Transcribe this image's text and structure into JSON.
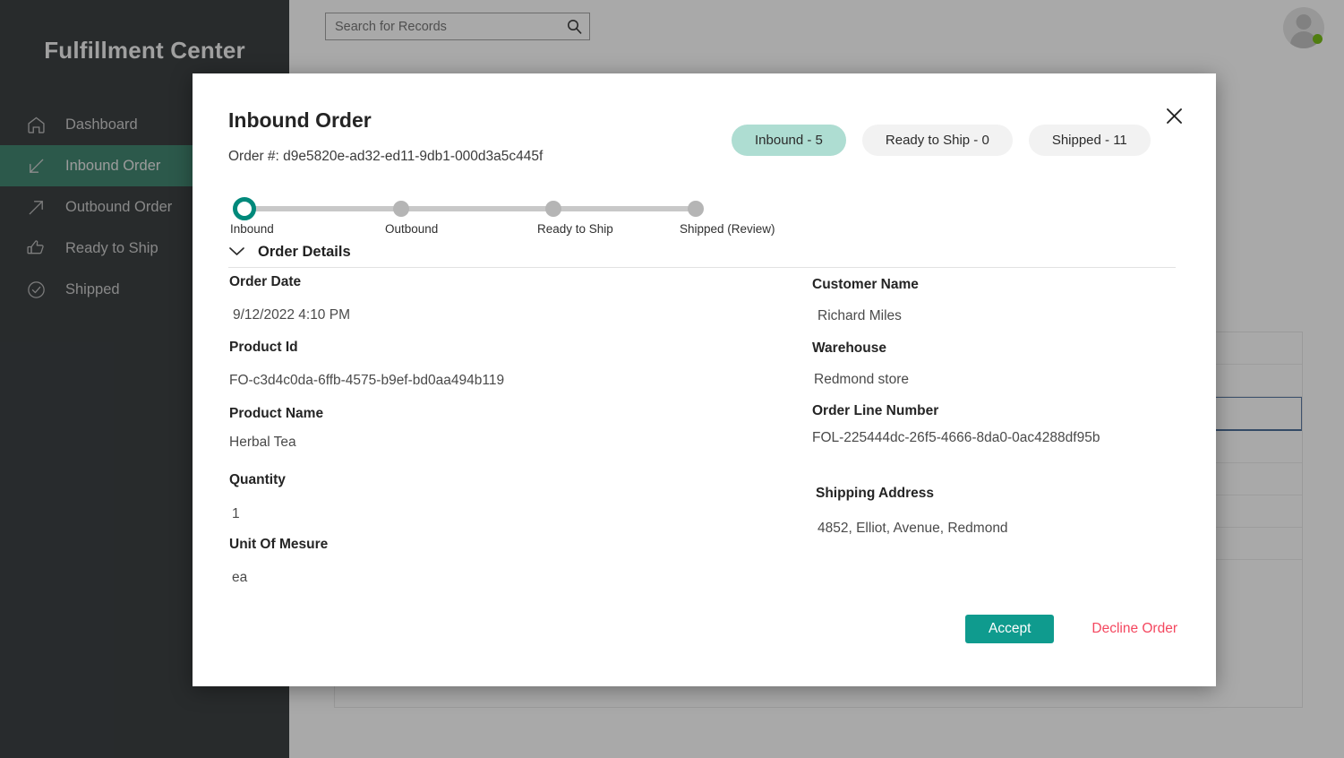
{
  "app": {
    "brand": "Fulfillment Center"
  },
  "search": {
    "placeholder": "Search for Records",
    "value": "",
    "icon": "search-icon"
  },
  "account": {
    "avatar_icon": "user-avatar-icon",
    "presence": "online",
    "presence_color": "#6bb700"
  },
  "sidebar": {
    "items": [
      {
        "label": "Dashboard",
        "icon": "home-icon",
        "active": false
      },
      {
        "label": "Inbound Order",
        "icon": "arrow-down-left-icon",
        "active": true
      },
      {
        "label": "Outbound Order",
        "icon": "arrow-up-right-icon",
        "active": false
      },
      {
        "label": "Ready to Ship",
        "icon": "thumbs-up-icon",
        "active": false
      },
      {
        "label": "Shipped",
        "icon": "check-circle-icon",
        "active": false
      }
    ],
    "active_bg": "#2f7a63",
    "bg": "#282d30"
  },
  "modal": {
    "title": "Inbound Order",
    "order_number_label": "Order #: d9e5820e-ad32-ed11-9db1-000d3a5c445f",
    "close_icon": "close-icon",
    "pills": [
      {
        "label": "Inbound - 5",
        "active": true
      },
      {
        "label": "Ready to Ship - 0",
        "active": false
      },
      {
        "label": "Shipped - 11",
        "active": false
      }
    ],
    "pill_active_color": "#aeddd2",
    "stepper": {
      "steps": [
        {
          "label": "Inbound",
          "state": "current"
        },
        {
          "label": "Outbound",
          "state": "upcoming"
        },
        {
          "label": "Ready to Ship",
          "state": "upcoming"
        },
        {
          "label": "Shipped (Review)",
          "state": "upcoming"
        }
      ],
      "active_color": "#00897b",
      "track_color": "#c8c8c8"
    },
    "section": {
      "title": "Order Details",
      "chevron_icon": "chevron-down-icon",
      "expanded": true
    },
    "fields_left": [
      {
        "label": "Order Date",
        "value": "9/12/2022 4:10 PM"
      },
      {
        "label": "Product Id",
        "value": "FO-c3d4c0da-6ffb-4575-b9ef-bd0aa494b119"
      },
      {
        "label": "Product Name",
        "value": "Herbal Tea"
      },
      {
        "label": "Quantity",
        "value": "1"
      },
      {
        "label": "Unit Of Mesure",
        "value": "ea"
      }
    ],
    "fields_right": [
      {
        "label": "Customer Name",
        "value": "Richard Miles"
      },
      {
        "label": "Warehouse",
        "value": "Redmond store"
      },
      {
        "label": "Order Line Number",
        "value": "FOL-225444dc-26f5-4666-8da0-0ac4288df95b"
      },
      {
        "label": "Shipping Address",
        "value": "4852, Elliot, Avenue, Redmond"
      }
    ],
    "actions": {
      "accept_label": "Accept",
      "accept_color": "#0f9b8e",
      "decline_label": "Decline Order",
      "decline_color": "#f4475f"
    }
  },
  "background_list": {
    "rows": [
      {
        "selected": false
      },
      {
        "selected": false
      },
      {
        "selected": true
      },
      {
        "selected": false
      },
      {
        "selected": false
      },
      {
        "selected": false
      },
      {
        "selected": false
      }
    ],
    "selected_border": "#4b6f9c"
  }
}
